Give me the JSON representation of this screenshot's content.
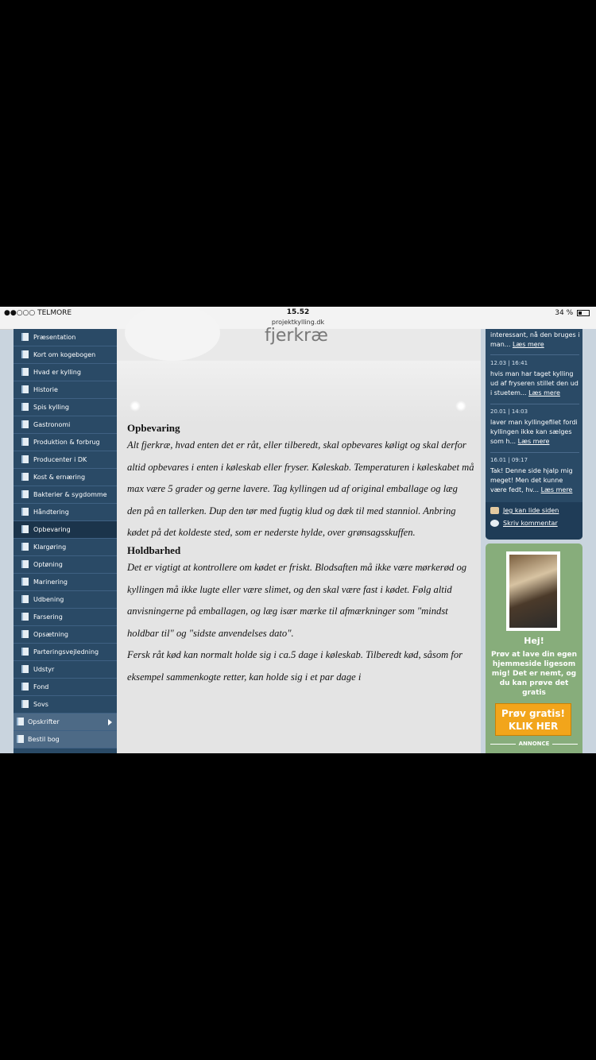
{
  "statusbar": {
    "carrier": "●●○○○ TELMORE",
    "time": "15.52",
    "url": "projektkylling.dk",
    "battery": "34 %"
  },
  "nav": {
    "items": [
      {
        "label": "Præsentation"
      },
      {
        "label": "Kort om kogebogen"
      },
      {
        "label": "Hvad er kylling"
      },
      {
        "label": "Historie"
      },
      {
        "label": "Spis kylling"
      },
      {
        "label": "Gastronomi"
      },
      {
        "label": "Produktion & forbrug"
      },
      {
        "label": "Producenter i DK"
      },
      {
        "label": "Kost & ernæring"
      },
      {
        "label": "Bakterier & sygdomme"
      },
      {
        "label": "Håndtering"
      },
      {
        "label": "Opbevaring"
      },
      {
        "label": "Klargøring"
      },
      {
        "label": "Optøning"
      },
      {
        "label": "Marinering"
      },
      {
        "label": "Udbening"
      },
      {
        "label": "Farsering"
      },
      {
        "label": "Opsætning"
      },
      {
        "label": "Parteringsvejledning"
      },
      {
        "label": "Udstyr"
      },
      {
        "label": "Fond"
      },
      {
        "label": "Sovs"
      }
    ],
    "recipes": "Opskrifter",
    "order": "Bestil bog"
  },
  "content": {
    "banner_title": "fjerkræ",
    "section1": {
      "heading": "Opbevaring",
      "body": "Alt fjerkræ, hvad enten det er råt, eller tilberedt, skal opbevares køligt og skal derfor altid opbevares i enten i køleskab eller fryser. Køleskab. Temperaturen i køleskabet må max være 5 grader og gerne lavere. Tag kyllingen ud af original emballage og læg den på en tallerken. Dup den tør med fugtig klud og dæk til med stanniol. Anbring kødet på det koldeste sted, som er nederste hylde, over grønsagsskuffen."
    },
    "section2": {
      "heading": "Holdbarhed",
      "body": "Det er vigtigt at kontrollere om kødet er friskt. Blodsaften må ikke være mørkerød og kyllingen må ikke lugte eller være slimet, og den skal være fast i kødet. Følg altid anvisningerne på emballagen, og læg især mærke til afmærkninger som \"mindst holdbar til\" og \"sidste anvendelses dato\".",
      "body2": "Fersk råt kød kan normalt holde sig i ca.5 dage i køleskab. Tilberedt kød, såsom for eksempel sammenkogte retter, kan holde sig i et par dage i"
    }
  },
  "sidebar": {
    "top_text": "interessant, nå den bruges i man...",
    "read_more": "Læs mere",
    "comments": [
      {
        "meta": "12.03 | 16:41",
        "text": "hvis man har taget kylling ud af fryseren stillet den ud i stuetem..."
      },
      {
        "meta": "20.01 | 14:03",
        "text": "laver man kyllingefilet fordi kyllingen ikke kan sælges som h..."
      },
      {
        "meta": "16.01 | 09:17",
        "text": "Tak! Denne side hjalp mig meget! Men det kunne være fedt, hv..."
      }
    ],
    "like": "Jeg kan lide siden",
    "write_comment": "Skriv kommentar"
  },
  "promo": {
    "heading": "Hej!",
    "text": "Prøv at lave din egen hjemmeside ligesom mig! Det er nemt, og du kan prøve det gratis",
    "button_line1": "Prøv gratis!",
    "button_line2": "KLIK HER",
    "annonce": "ANNONCE"
  }
}
